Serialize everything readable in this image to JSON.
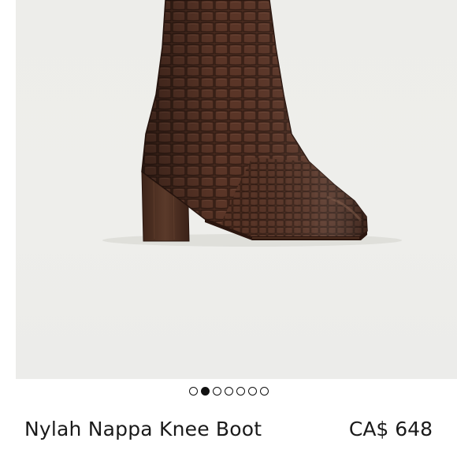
{
  "product": {
    "name": "Nylah Nappa Knee Boot",
    "price": "CA$ 648",
    "image_alt": "Brown croc-embossed knee boot with block heel"
  },
  "gallery": {
    "total_images": 7,
    "active_index": 1
  },
  "colors": {
    "boot": "#4a2a1f",
    "background": "#ededea"
  }
}
